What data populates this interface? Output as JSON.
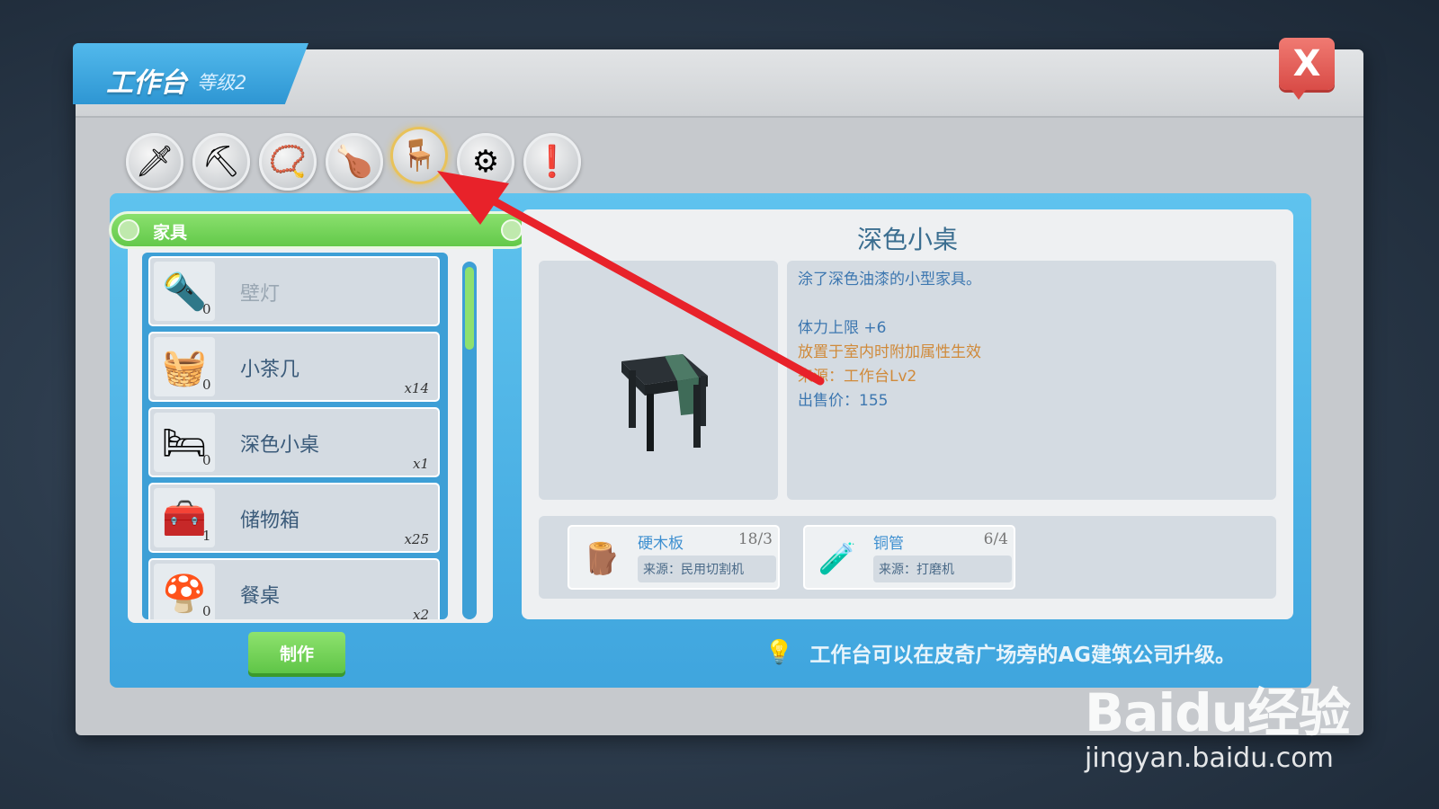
{
  "window": {
    "title": "工作台",
    "level": "等级2",
    "close_label": "X"
  },
  "category_tabs": [
    {
      "icon": "sword-icon",
      "glyph": "🗡"
    },
    {
      "icon": "pickaxe-icon",
      "glyph": "⛏"
    },
    {
      "icon": "necklace-icon",
      "glyph": "📿"
    },
    {
      "icon": "food-icon",
      "glyph": "🍗"
    },
    {
      "icon": "chair-icon",
      "glyph": "🪑",
      "active": true
    },
    {
      "icon": "gear-icon",
      "glyph": "⚙"
    },
    {
      "icon": "exclamation-icon",
      "glyph": "❗"
    }
  ],
  "list": {
    "category": "家具",
    "items": [
      {
        "name": "壁灯",
        "owned": "0",
        "qty": "",
        "glyph": "🔦",
        "dim": true
      },
      {
        "name": "小茶几",
        "owned": "0",
        "qty": "x14",
        "glyph": "🧺"
      },
      {
        "name": "深色小桌",
        "owned": "0",
        "qty": "x1",
        "glyph": "🛏"
      },
      {
        "name": "储物箱",
        "owned": "1",
        "qty": "x25",
        "glyph": "🧰"
      },
      {
        "name": "餐桌",
        "owned": "0",
        "qty": "x2",
        "glyph": "🍄"
      }
    ]
  },
  "detail": {
    "title": "深色小桌",
    "description": "涂了深色油漆的小型家具。",
    "stat": "体力上限 +6",
    "effect": "放置于室内时附加属性生效",
    "source": "来源：工作台Lv2",
    "price": "出售价：155"
  },
  "materials": [
    {
      "name": "硬木板",
      "count": "18/3",
      "source": "来源：民用切割机",
      "glyph": "🪵"
    },
    {
      "name": "铜管",
      "count": "6/4",
      "source": "来源：打磨机",
      "glyph": "🧪"
    }
  ],
  "craft_label": "制作",
  "tip": "工作台可以在皮奇广场旁的AG建筑公司升级。",
  "watermark": {
    "main": "Baidu经验",
    "url": "jingyan.baidu.com"
  },
  "colors": {
    "accent_blue": "#3fa5de",
    "accent_green": "#63c94a",
    "close_red": "#d94c47",
    "arrow_red": "#e8222a"
  }
}
